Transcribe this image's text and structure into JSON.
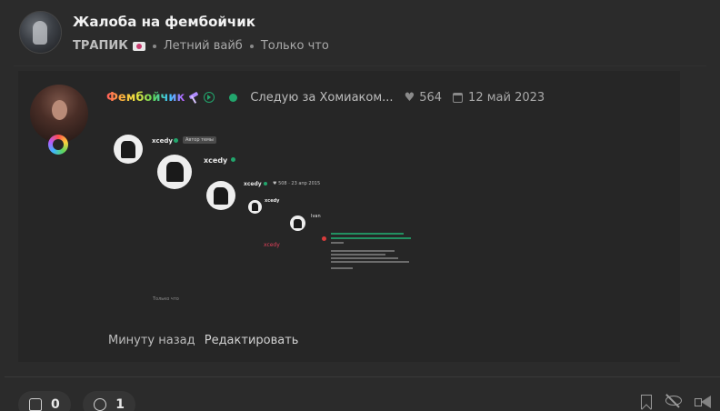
{
  "thread": {
    "title": "Жалоба на фембойчик",
    "forum": "ТРАПИК",
    "tag": "Летний вайб",
    "time": "Только что"
  },
  "post": {
    "author": "Фембойчик",
    "status": "Следую за Хомиаком...",
    "likes": "564",
    "date": "12 май 2023",
    "time_ago": "Минуту назад",
    "edit_label": "Редактировать",
    "embedded_screenshot": {
      "user_1": "xcedy",
      "author_tag": "Автор темы",
      "user_2": "xcedy",
      "user_3": "xcedy",
      "user_3_meta": "♥ 508 · 23 апр 2015",
      "user_4": "xcedy",
      "user_5": "Ivan",
      "red_nick": "xcedy",
      "time": "Только что"
    }
  },
  "actions": {
    "likes": "0",
    "comments": "1"
  },
  "colors": {
    "background": "#2b2b2b",
    "panel": "#262626",
    "online": "#22a56c",
    "accent_red": "#e0405a"
  }
}
